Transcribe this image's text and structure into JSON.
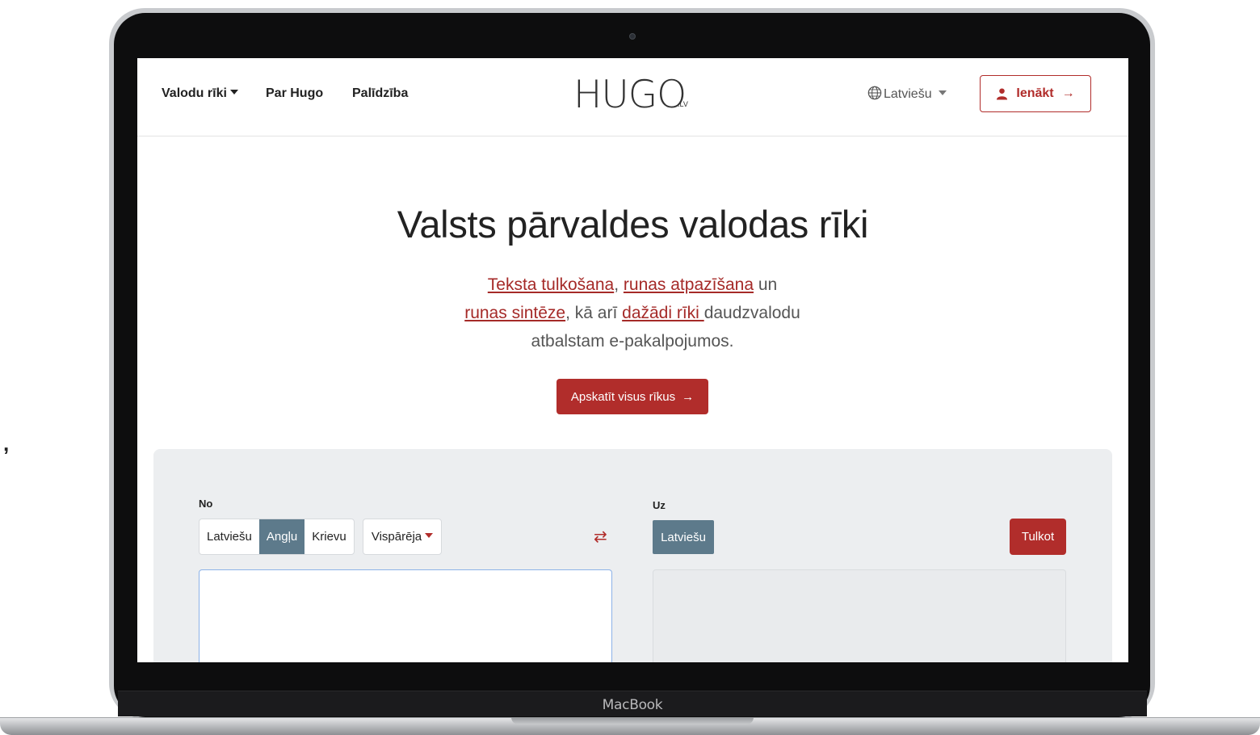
{
  "stray_mark": ",",
  "device": {
    "label": "MacBook"
  },
  "nav": {
    "tools_label": "Valodu rīki",
    "about_label": "Par Hugo",
    "help_label": "Palīdzība",
    "logo_text": "HUGO",
    "logo_suffix": ".LV",
    "language_label": "Latviešu",
    "login_label": "Ienākt"
  },
  "hero": {
    "title": "Valsts pārvaldes valodas rīki",
    "link_translate": "Teksta tulkošana",
    "sep1": ", ",
    "link_recognition": "runas atpazīšana",
    "text1": " un",
    "link_synthesis": "runas sintēze",
    "text2": ", kā arī ",
    "link_tools": "dažādi rīki ",
    "text3": "daudzvalodu atbalstam e-pakalpojumos.",
    "cta_label": "Apskatīt visus rīkus"
  },
  "translator": {
    "from_label": "No",
    "to_label": "Uz",
    "source_languages": [
      "Latviešu",
      "Angļu",
      "Krievu"
    ],
    "selected_source": "Angļu",
    "domain_label": "Vispārēja",
    "target_language": "Latviešu",
    "translate_label": "Tulkot",
    "source_text": "",
    "output_text": ""
  },
  "colors": {
    "accent": "#b12d2b",
    "selected": "#5d7a8b",
    "panel": "#eceef0"
  }
}
